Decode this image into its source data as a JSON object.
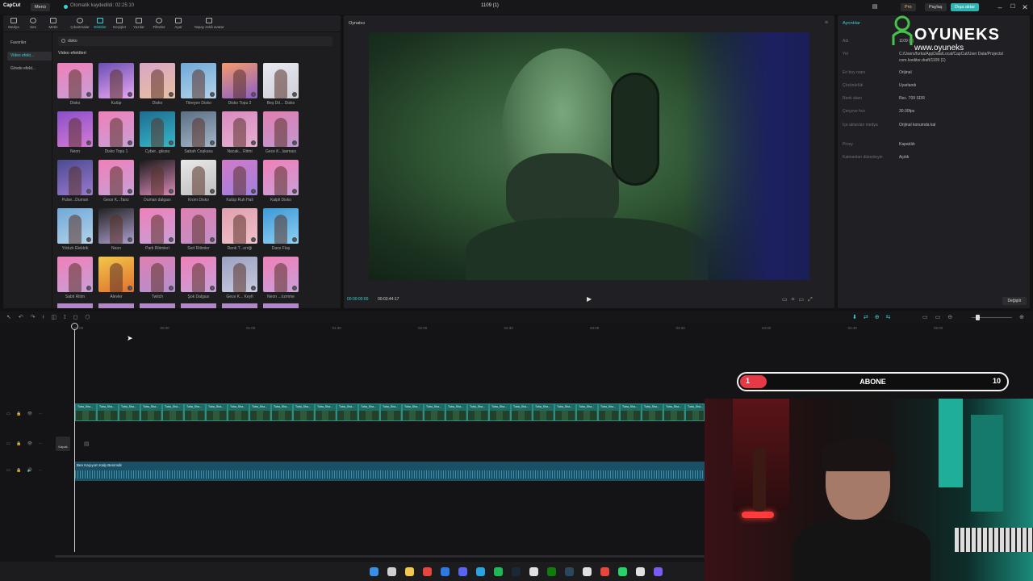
{
  "titlebar": {
    "logo": "CapCut",
    "menu": "Menü",
    "autosave": "Otomatik kaydedildi: 02:25:10",
    "project": "1109 (1)",
    "pro": "Pro",
    "share": "Paylaş",
    "export": "Dışa aktar"
  },
  "toolbar": {
    "items": [
      "Medya",
      "Ses",
      "Metin",
      "Çıkartmalar",
      "Efektler",
      "Geçişler",
      "Yazılar",
      "Filtreler",
      "Ayar",
      "Yapay zekâ avatar"
    ]
  },
  "leftnav": {
    "items": [
      "Favoriler",
      "Video efekt...",
      "Gövde efekt..."
    ]
  },
  "effects": {
    "search_value": "disko",
    "section_title": "Video efektleri",
    "items": [
      "Disko",
      "Kulüp",
      "Disko",
      "Titreyen Disko",
      "Disko Topu 2",
      "Beş Dö... Disko",
      "Neon",
      "Disko Topu 1",
      "Cyber...gkusu",
      "Sabah Coşkusu",
      "Nacak... Ritmi",
      "Gece K...lasması",
      "Pulse...Duman",
      "Gece K...Tanz",
      "Duman dalgası",
      "Krom Disko",
      "Kulüp Ruh Hali",
      "Kalpli Disko",
      "Yıldızlı Elektrik",
      "Neon",
      "Parti Ritimleri",
      "Sert Ritimler",
      "Renk T...erriği",
      "Dans Flaş",
      "Sabit Ritim",
      "Alevler",
      "Twitch",
      "Şok Dalgası",
      "Gece K... Keyfi",
      "Neon ...özmme"
    ]
  },
  "player": {
    "title": "Oynatıcı",
    "time_current": "00:00:00:00",
    "time_total": "00:03:44:17"
  },
  "props": {
    "title": "Ayrıntılar",
    "rows": [
      {
        "k": "Adı",
        "v": "1109 (1)"
      },
      {
        "k": "Yol",
        "v": "C:/Users/furka/AppData/Local/CapCut/User Data/Projects/"
      },
      {
        "k": "",
        "v": "com.lveditor.draft/1109 (1)"
      },
      {
        "k": "En boy oranı",
        "v": "Orijinal"
      },
      {
        "k": "Çözünürlük",
        "v": "Uyarlandı"
      },
      {
        "k": "Renk alanı",
        "v": "Rec. 709 SDR"
      },
      {
        "k": "Çerçeve hızı",
        "v": "30.00fps"
      },
      {
        "k": "İçe aktarılan medya",
        "v": "Orijinal konumda kal"
      },
      {
        "k": "Proxy",
        "v": "Kapatıldı"
      },
      {
        "k": "Katmanları düzenleyin",
        "v": "Açıldı"
      }
    ],
    "change_button": "Değiştir"
  },
  "timeline": {
    "ruler": [
      "00:00",
      "00:30",
      "01:00",
      "01:30",
      "02:00",
      "02:30",
      "03:00",
      "03:30",
      "04:00",
      "04:30",
      "05:00"
    ],
    "cover_label": "Kapak",
    "clip_label": "Tuba_Sha...",
    "audio_label": "Ben Kaçıyom Kalp Benimdir"
  },
  "overlay": {
    "brand_name": "OYUNEKS",
    "brand_url": "www.oyuneks",
    "sub_current": "1",
    "sub_label": "ABONE",
    "sub_goal": "10",
    "sub_progress": 0.1
  },
  "colors": {
    "accent": "#3ad2d2",
    "clip": "#1e6b66",
    "audio": "#1b4f63",
    "brand": "#46c24a",
    "sub_fill": "#e63946"
  }
}
